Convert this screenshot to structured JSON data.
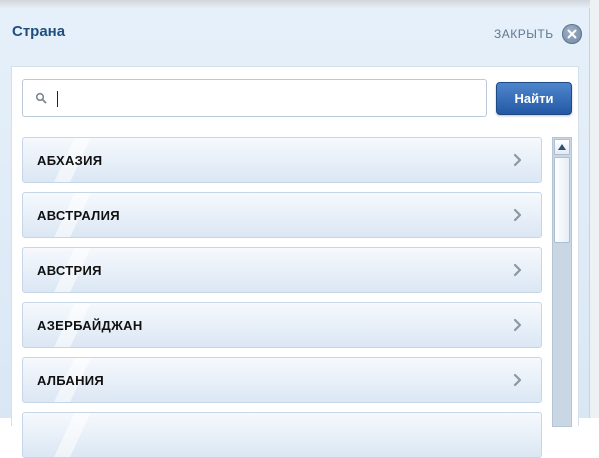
{
  "dialog": {
    "title": "Страна",
    "close_label": "ЗАКРЫТЬ"
  },
  "search": {
    "value": "",
    "placeholder": "",
    "button_label": "Найти"
  },
  "countries": [
    {
      "label": "АБХАЗИЯ"
    },
    {
      "label": "АВСТРАЛИЯ"
    },
    {
      "label": "АВСТРИЯ"
    },
    {
      "label": "АЗЕРБАЙДЖАН"
    },
    {
      "label": "АЛБАНИЯ"
    },
    {
      "label": ""
    }
  ],
  "colors": {
    "accent": "#2458a5",
    "title": "#1f4f7f",
    "panel": "#e6f0fa"
  },
  "icons": {
    "search": "search-icon",
    "close": "close-icon",
    "chevron": "chevron-right-icon",
    "scroll_up": "arrow-up-icon"
  }
}
